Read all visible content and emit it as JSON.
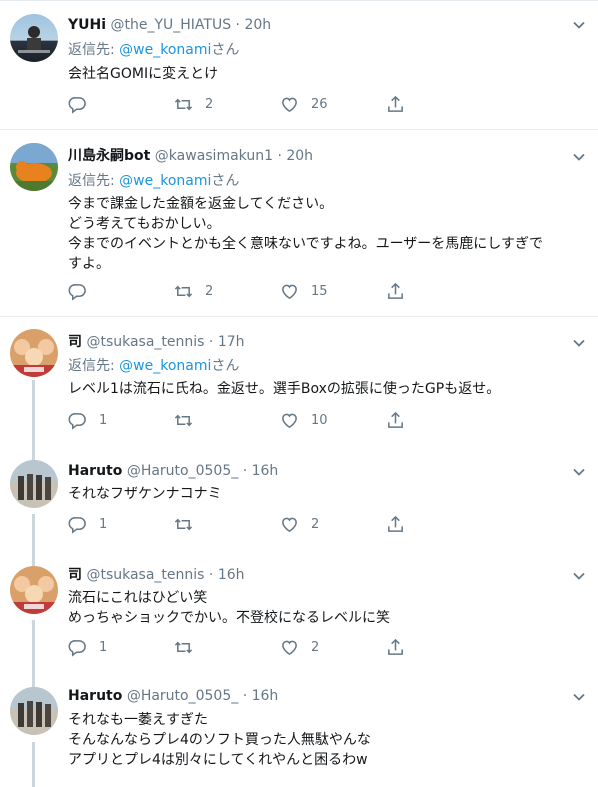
{
  "colors": {
    "accent": "#1b95e0",
    "muted": "#657786",
    "text": "#14171a",
    "border": "#e6ecf0",
    "thread": "#ccd6dd"
  },
  "icons": {
    "reply": "reply-icon",
    "retweet": "retweet-icon",
    "like": "heart-icon",
    "share": "share-icon",
    "more": "chevron-down-icon"
  },
  "tweets": [
    {
      "name": "YUHi",
      "handle": "@the_YU_HIATUS",
      "dot": "·",
      "time": "20h",
      "reply_label": "返信先:",
      "reply_to": "@we_konami",
      "reply_suffix": "さん",
      "text": "会社名GOMIに変えとけ",
      "replies": "",
      "retweets": "2",
      "likes": "26"
    },
    {
      "name": "川島永嗣bot",
      "handle": "@kawasimakun1",
      "dot": "·",
      "time": "20h",
      "reply_label": "返信先:",
      "reply_to": "@we_konami",
      "reply_suffix": "さん",
      "text": "今まで課金した金額を返金してください。\nどう考えてもおかしい。\n今までのイベントとかも全く意味ないですよね。ユーザーを馬鹿にしすぎで\nすよ。",
      "replies": "",
      "retweets": "2",
      "likes": "15"
    },
    {
      "name": "司",
      "handle": "@tsukasa_tennis",
      "dot": "·",
      "time": "17h",
      "reply_label": "返信先:",
      "reply_to": "@we_konami",
      "reply_suffix": "さん",
      "text": "レベル1は流石に氏ね。金返せ。選手Boxの拡張に使ったGPも返せ。",
      "replies": "1",
      "retweets": "",
      "likes": "10"
    },
    {
      "name": "Haruto",
      "handle": "@Haruto_0505_",
      "dot": "·",
      "time": "16h",
      "text": "それなフザケンナコナミ",
      "replies": "1",
      "retweets": "",
      "likes": "2"
    },
    {
      "name": "司",
      "handle": "@tsukasa_tennis",
      "dot": "·",
      "time": "16h",
      "text": "流石にこれはひどい笑\nめっちゃショックでかい。不登校になるレベルに笑",
      "replies": "1",
      "retweets": "",
      "likes": "2"
    },
    {
      "name": "Haruto",
      "handle": "@Haruto_0505_",
      "dot": "·",
      "time": "16h",
      "text": "それなも一萎えすぎた\nそんなんならプレ4のソフト買った人無駄やんな\nアプリとプレ4は別々にしてくれやんと困るわw"
    }
  ]
}
